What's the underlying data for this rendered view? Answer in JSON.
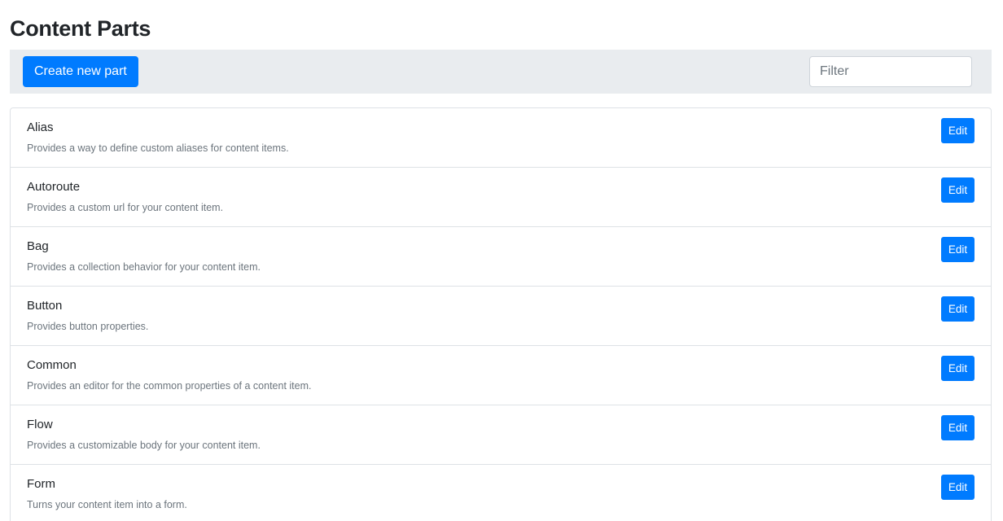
{
  "header": {
    "title": "Content Parts"
  },
  "toolbar": {
    "create_label": "Create new part",
    "filter_placeholder": "Filter"
  },
  "parts": [
    {
      "name": "Alias",
      "description": "Provides a way to define custom aliases for content items.",
      "edit_label": "Edit"
    },
    {
      "name": "Autoroute",
      "description": "Provides a custom url for your content item.",
      "edit_label": "Edit"
    },
    {
      "name": "Bag",
      "description": "Provides a collection behavior for your content item.",
      "edit_label": "Edit"
    },
    {
      "name": "Button",
      "description": "Provides button properties.",
      "edit_label": "Edit"
    },
    {
      "name": "Common",
      "description": "Provides an editor for the common properties of a content item.",
      "edit_label": "Edit"
    },
    {
      "name": "Flow",
      "description": "Provides a customizable body for your content item.",
      "edit_label": "Edit"
    },
    {
      "name": "Form",
      "description": "Turns your content item into a form.",
      "edit_label": "Edit"
    }
  ],
  "colors": {
    "primary": "#007bff",
    "toolbar_bg": "#e9ecef",
    "border": "#dee2e6",
    "muted_text": "#6c757d"
  }
}
